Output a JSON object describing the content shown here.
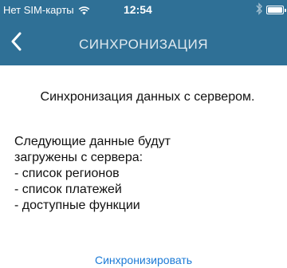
{
  "status_bar": {
    "carrier": "Нет SIM-карты",
    "time": "12:54",
    "battery_level_percent": 100
  },
  "nav": {
    "title": "СИНХРОНИЗАЦИЯ",
    "back_icon": "chevron-left-icon"
  },
  "content": {
    "heading": "Синхронизация данных с сервером.",
    "description_lines": [
      "Следующие данные будут",
      "загружены с сервера:",
      "- список регионов",
      "- список платежей",
      "- доступные функции"
    ],
    "sync_button_label": "Синхронизировать"
  },
  "colors": {
    "header_background": "#2f7096",
    "link": "#1b7ad6",
    "text": "#111111"
  }
}
